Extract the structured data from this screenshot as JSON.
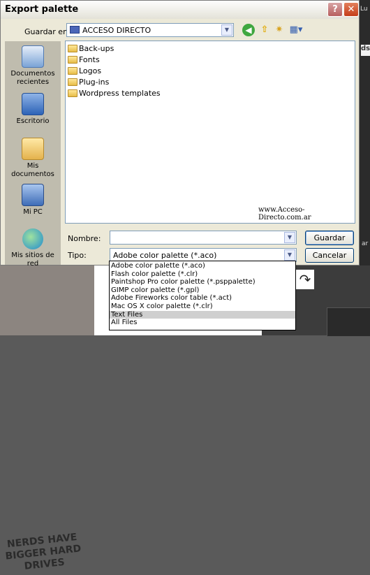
{
  "dialog": {
    "title": "Export palette",
    "help_label": "?",
    "close_label": "✕"
  },
  "look_in": {
    "label": "Guardar en:",
    "value": "ACCESO DIRECTO"
  },
  "toolbar": {
    "back_icon": "back-icon",
    "up_icon": "up-folder-icon",
    "new_folder_icon": "new-folder-icon",
    "views_icon": "views-menu-icon"
  },
  "places": [
    {
      "label": "Documentos recientes",
      "icon": "recent-documents-icon"
    },
    {
      "label": "Escritorio",
      "icon": "desktop-icon"
    },
    {
      "label": "Mis documentos",
      "icon": "my-documents-icon"
    },
    {
      "label": "Mi PC",
      "icon": "my-computer-icon"
    },
    {
      "label": "Mis sitios de red",
      "icon": "network-places-icon"
    }
  ],
  "files": [
    {
      "name": "Back-ups"
    },
    {
      "name": "Fonts"
    },
    {
      "name": "Logos"
    },
    {
      "name": "Plug-ins"
    },
    {
      "name": "Wordpress templates"
    }
  ],
  "watermark": "www.Acceso-Directo.com.ar",
  "name_field": {
    "label": "Nombre:",
    "value": ""
  },
  "type_field": {
    "label": "Tipo:",
    "value": "Adobe color palette (*.aco)",
    "options": [
      "Adobe color palette (*.aco)",
      "Flash color palette (*.clr)",
      "Paintshop Pro color palette (*.psppalette)",
      "GIMP color palette (*.gpl)",
      "Adobe Fireworks color table (*.act)",
      "Mac OS X color palette (*.clr)",
      "Text Files",
      "All Files"
    ],
    "highlighted_option": "Text Files"
  },
  "buttons": {
    "save": "Guardar",
    "cancel": "Cancelar"
  },
  "background": {
    "shirt_text": "NERDS HAVE BIGGER HARD DRIVES",
    "top_right_text": "Lu",
    "right_edge_text": "ds",
    "top_right_small_text": "ar"
  }
}
